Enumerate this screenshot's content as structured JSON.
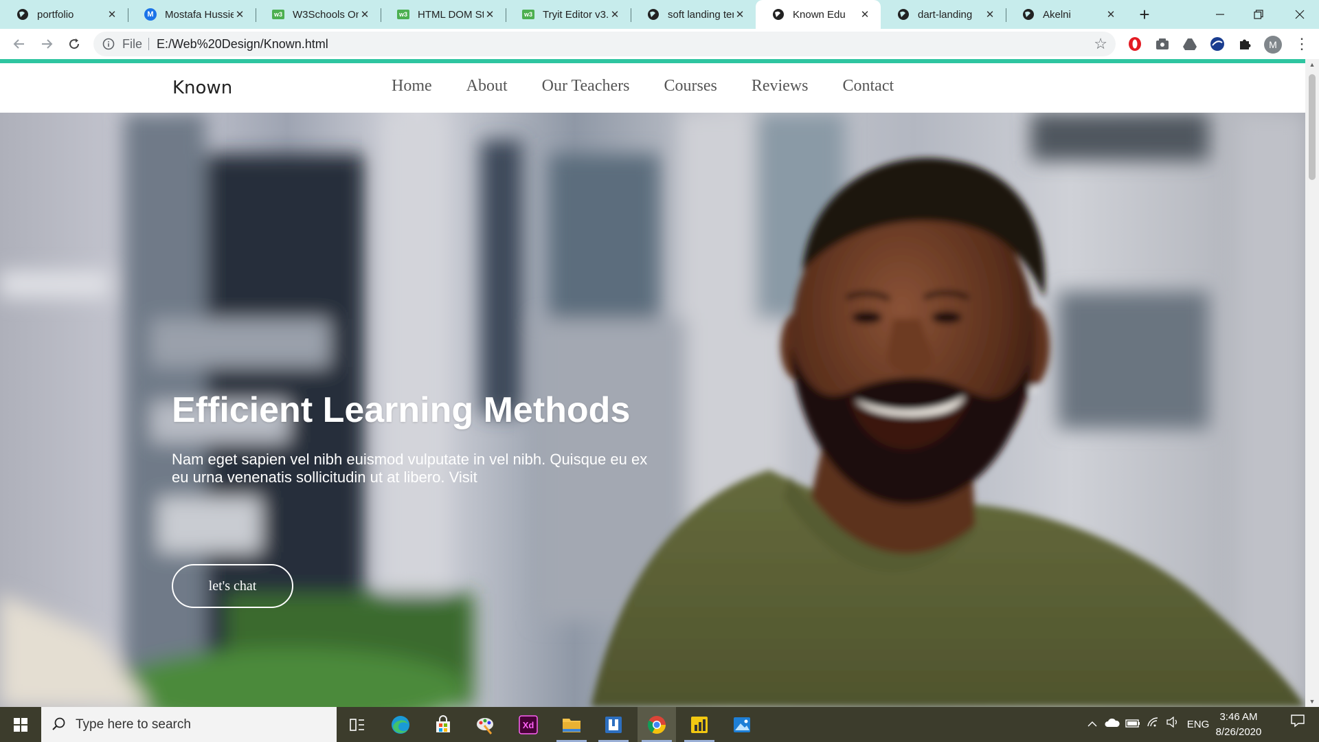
{
  "browser": {
    "tabs": [
      {
        "title": "portfolio",
        "icon": "globe-icon",
        "active": false
      },
      {
        "title": "Mostafa Hussie",
        "icon": "m-icon",
        "active": false
      },
      {
        "title": "W3Schools Onl",
        "icon": "w3schools-icon",
        "active": false
      },
      {
        "title": "HTML DOM Sty",
        "icon": "w3schools-icon",
        "active": false
      },
      {
        "title": "Tryit Editor v3.6",
        "icon": "w3schools-icon",
        "active": false
      },
      {
        "title": "soft landing ter",
        "icon": "globe-icon",
        "active": false
      },
      {
        "title": "Known Edu",
        "icon": "globe-icon",
        "active": true
      },
      {
        "title": "dart-landing",
        "icon": "globe-icon",
        "active": false
      },
      {
        "title": "Akelni",
        "icon": "globe-icon",
        "active": false
      }
    ],
    "new_tab": "+",
    "address": {
      "scheme_label": "File",
      "url": "E:/Web%20Design/Known.html"
    },
    "profile_initial": "M"
  },
  "site": {
    "logo": "Known",
    "menu": [
      "Home",
      "About",
      "Our Teachers",
      "Courses",
      "Reviews",
      "Contact"
    ],
    "hero": {
      "title": "Efficient Learning Methods",
      "text": "Nam eget sapien vel nibh euismod vulputate in vel nibh. Quisque eu ex eu urna venenatis sollicitudin ut at libero. Visit",
      "button": "let's chat"
    },
    "colors": {
      "accent": "#2ec5a0"
    }
  },
  "taskbar": {
    "search_placeholder": "Type here to search",
    "apps": [
      "task-view-icon",
      "edge-icon",
      "store-icon",
      "paint-icon",
      "xd-icon",
      "file-explorer-icon",
      "app-icon",
      "chrome-icon",
      "powerbi-icon",
      "photos-icon"
    ],
    "language": "ENG",
    "time": "3:46 AM",
    "date": "8/26/2020"
  }
}
